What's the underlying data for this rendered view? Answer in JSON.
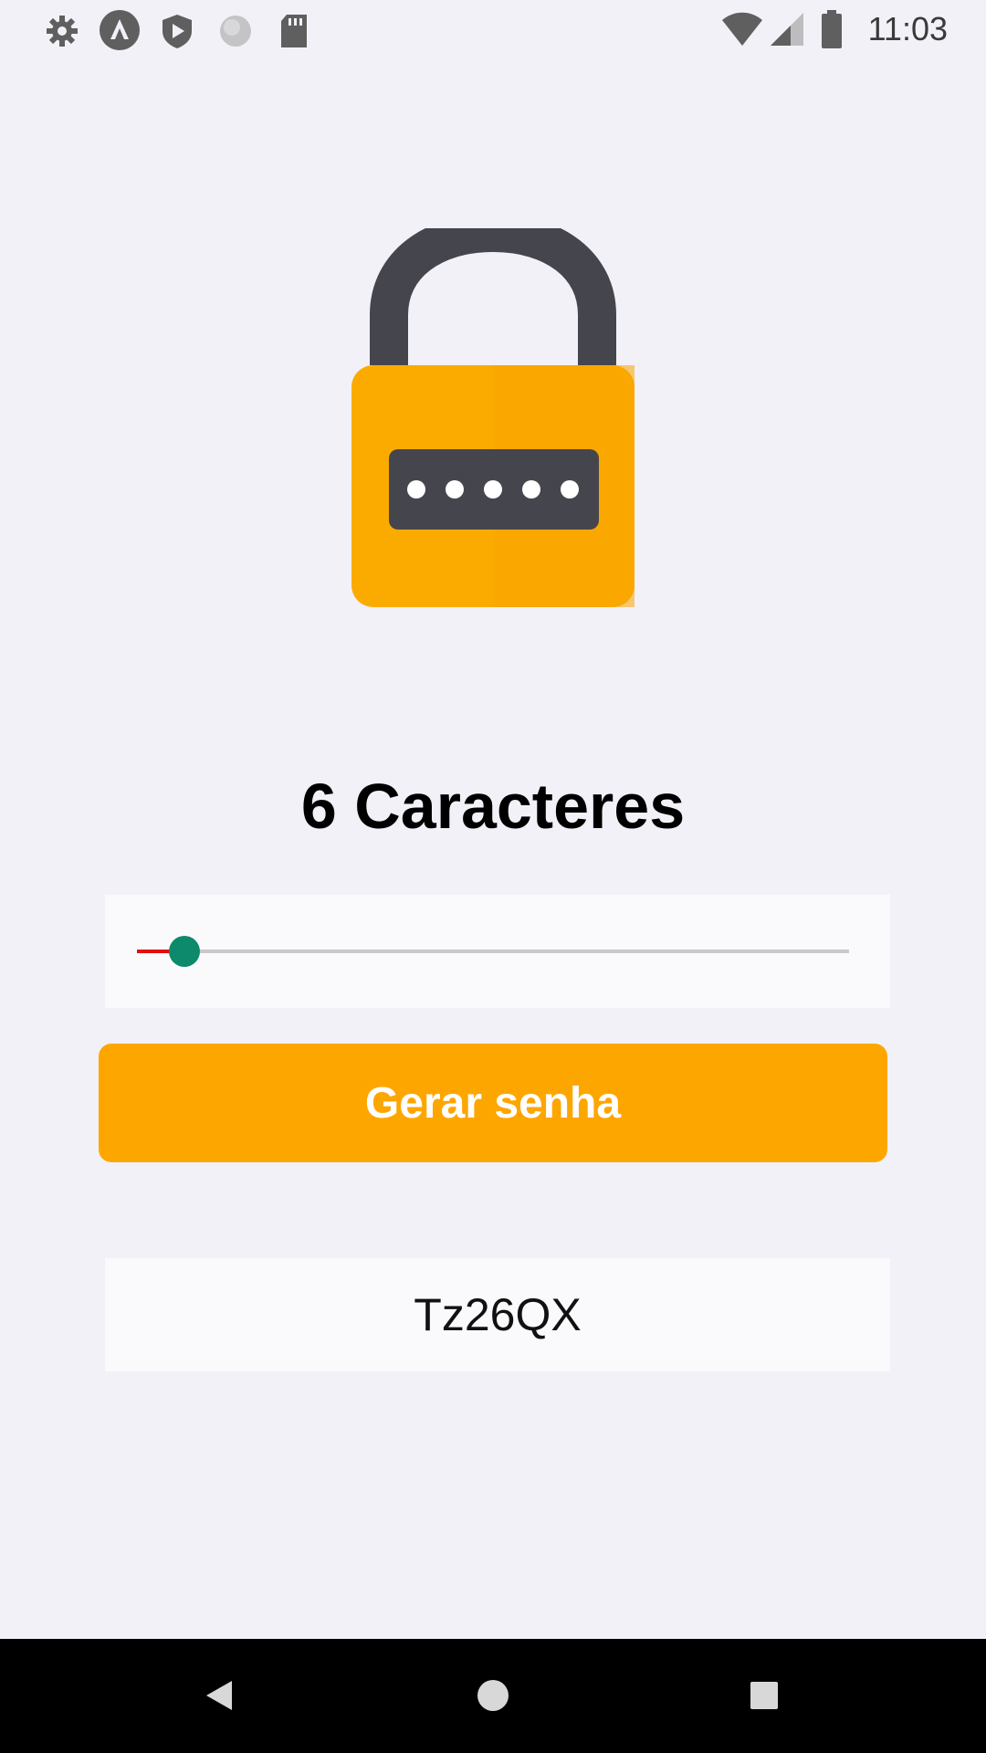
{
  "status_bar": {
    "time": "11:03",
    "left_icons": [
      "gear-icon",
      "app-a-icon",
      "shield-play-icon",
      "circle-icon",
      "sd-card-icon"
    ],
    "right_icons": [
      "wifi-icon",
      "cell-signal-icon",
      "battery-icon"
    ]
  },
  "main": {
    "title": "6 Caracteres",
    "slider": {
      "value": 6,
      "min": 5,
      "max": 20,
      "fill_color": "#e01010",
      "thumb_color": "#0d8a6c"
    },
    "generate_button_label": "Gerar senha",
    "generate_button_color": "#fea600",
    "generated_password": "Tz26QX"
  },
  "lock_icon": {
    "body_color": "#fbab00",
    "shackle_color": "#45464d",
    "display_color": "#45464d"
  },
  "nav_bar": {
    "buttons": [
      "back-icon",
      "home-icon",
      "recents-icon"
    ]
  }
}
